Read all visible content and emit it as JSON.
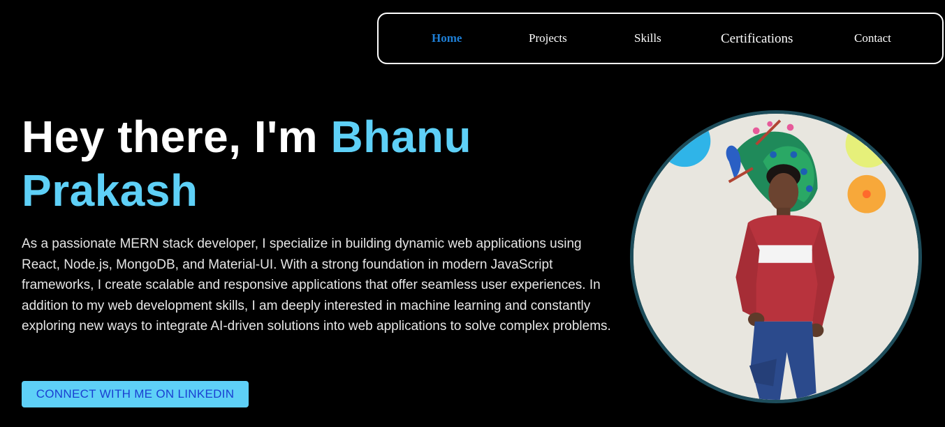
{
  "nav": {
    "items": [
      {
        "label": "Home",
        "active": true
      },
      {
        "label": "Projects",
        "active": false
      },
      {
        "label": "Skills",
        "active": false
      },
      {
        "label": "Certifications",
        "active": false
      },
      {
        "label": "Contact",
        "active": false
      }
    ]
  },
  "hero": {
    "greeting": "Hey there, I'm ",
    "name": "Bhanu Prakash",
    "description": "As a passionate MERN stack developer, I specialize in building dynamic web applications using React, Node.js, MongoDB, and Material-UI. With a strong foundation in modern JavaScript frameworks, I create scalable and responsive applications that offer seamless user experiences. In addition to my web development skills, I am deeply interested in machine learning and constantly exploring new ways to integrate AI-driven solutions into web applications to solve complex problems.",
    "cta_label": "CONNECT WITH ME ON LINKEDIN"
  },
  "colors": {
    "background": "#000000",
    "accent": "#5ed0f7",
    "nav_active": "#1e7fd6",
    "cta_text": "#1a3fd1",
    "photo_border": "#1d4c5a"
  },
  "icons": {
    "profile_photo": "profile-photo"
  }
}
